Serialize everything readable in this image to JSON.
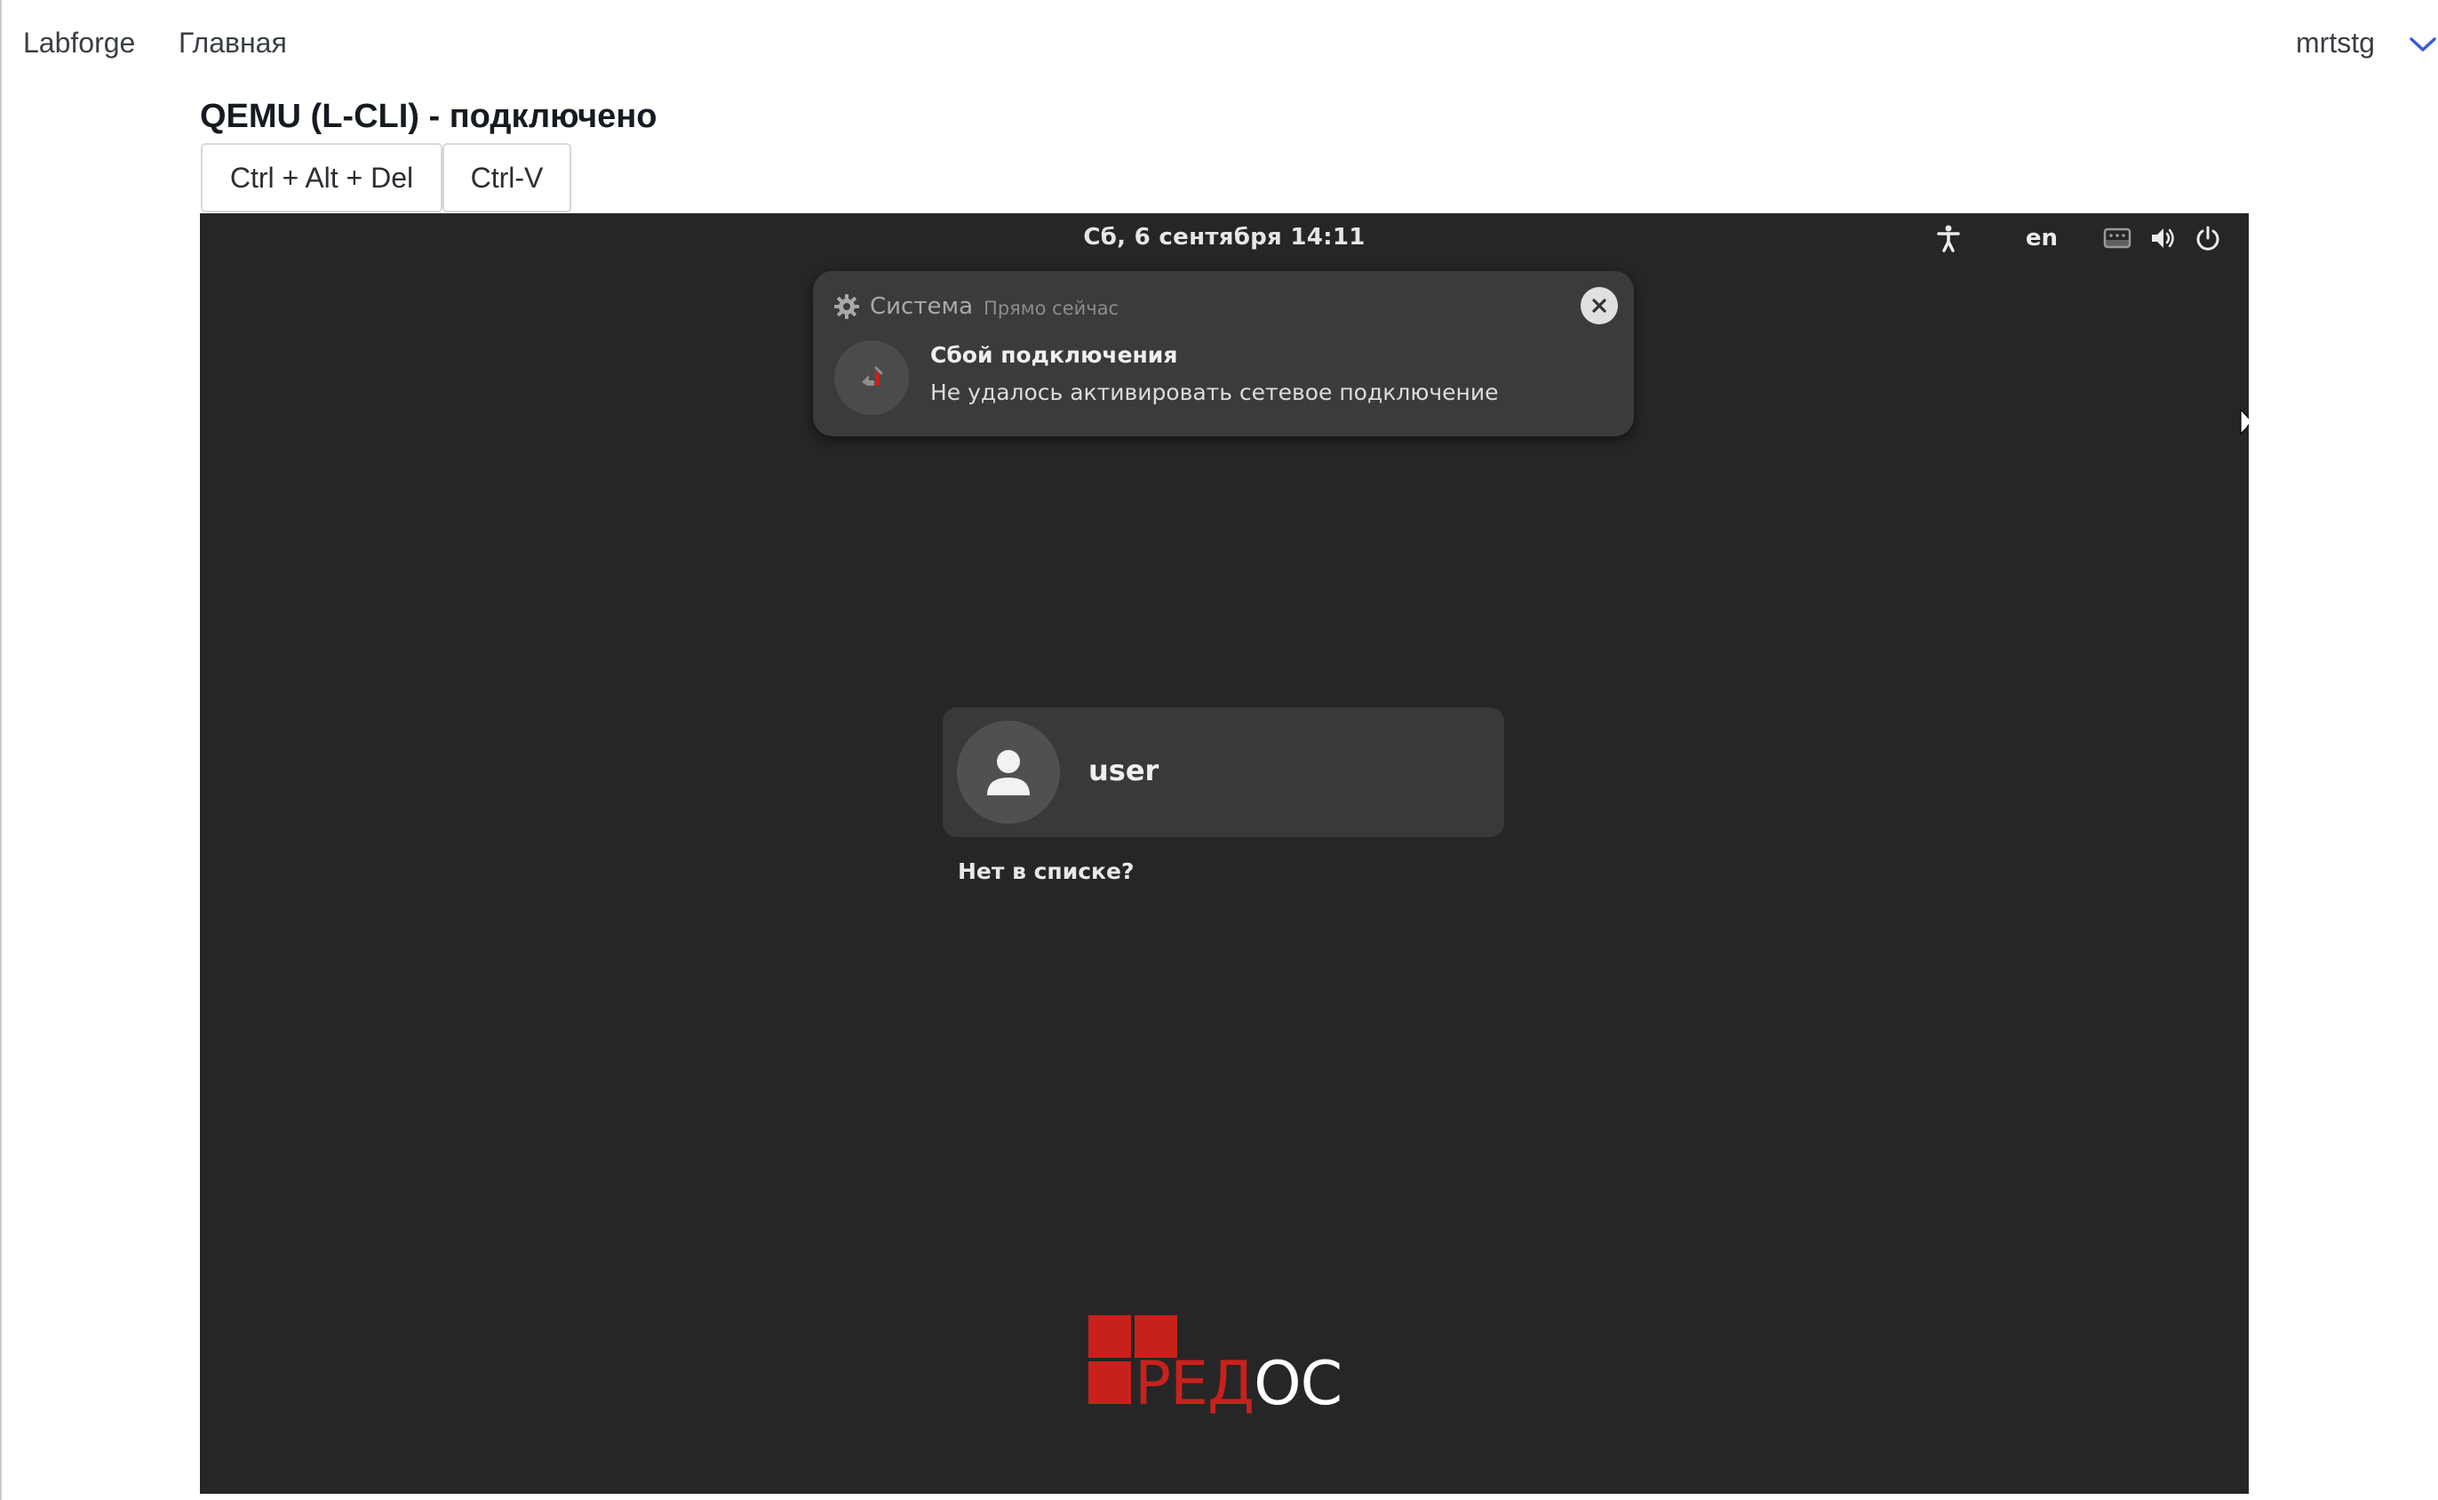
{
  "nav": {
    "brand": "Labforge",
    "home": "Главная",
    "user": "mrtstg"
  },
  "vm": {
    "title": "QEMU (L-CLI) - подключено",
    "buttons": {
      "ctrl_alt_del": "Ctrl + Alt + Del",
      "ctrl_v": "Ctrl-V"
    }
  },
  "guest": {
    "clock": "Сб, 6 сентября  14:11",
    "language": "en",
    "tray_icons": [
      "accessibility-icon",
      "network-icon",
      "volume-icon",
      "power-icon"
    ],
    "notification": {
      "app": "Система",
      "time": "Прямо сейчас",
      "title": "Сбой подключения",
      "body": "Не удалось активировать сетевое подключение"
    },
    "login": {
      "user": "user",
      "not_listed": "Нет в списке?"
    },
    "logo": {
      "text_red": "РЕД",
      "text_white": "ОС"
    }
  },
  "colors": {
    "accent": "#3b5bdb",
    "vm_background": "#262626",
    "logo_red": "#c8211c"
  }
}
